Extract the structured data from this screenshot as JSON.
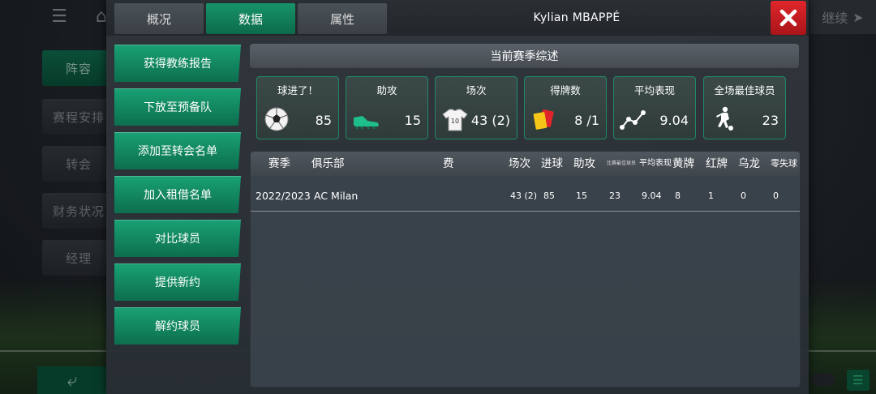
{
  "background_app": {
    "sidebar": [
      "阵容",
      "赛程安排",
      "转会",
      "财务状况",
      "经理"
    ],
    "continue_label": "继续"
  },
  "modal": {
    "tabs": [
      "概况",
      "数据",
      "属性"
    ],
    "active_tab": "数据",
    "player_name": "Kylian MBAPPÉ",
    "actions": [
      "获得教练报告",
      "下放至预备队",
      "添加至转会名单",
      "加入租借名单",
      "对比球员",
      "提供新约",
      "解约球员"
    ],
    "summary_title": "当前赛季综述",
    "stats": [
      {
        "label": "球进了！",
        "value": "85",
        "icon": "football-icon"
      },
      {
        "label": "助攻",
        "value": "15",
        "icon": "boot-icon"
      },
      {
        "label": "场次",
        "value": "43 (2)",
        "icon": "jersey-icon"
      },
      {
        "label": "得牌数",
        "value": "8 /1",
        "icon": "cards-icon"
      },
      {
        "label": "平均表现",
        "value": "9.04",
        "icon": "trend-icon"
      },
      {
        "label": "全场最佳球员",
        "value": "23",
        "icon": "player-icon"
      }
    ],
    "table": {
      "headers": {
        "season": "赛季",
        "club": "俱乐部",
        "fee": "费",
        "apps": "场次",
        "goals": "进球",
        "assists": "助攻",
        "motm": "比赛最佳球员",
        "avg": "平均表现",
        "yellow": "黄牌",
        "red": "红牌",
        "own_goals": "乌龙",
        "conceded": "零失球"
      },
      "rows": [
        {
          "season": "2022/2023",
          "club": "AC Milan",
          "fee": "",
          "apps": "43 (2)",
          "goals": "85",
          "assists": "15",
          "motm": "23",
          "avg": "9.04",
          "yellow": "8",
          "red": "1",
          "own_goals": "0",
          "conceded": "0"
        }
      ]
    }
  },
  "colors": {
    "accent_green": "#139a6d",
    "close_red": "#d8262a",
    "stat_border": "#1f8a66"
  }
}
